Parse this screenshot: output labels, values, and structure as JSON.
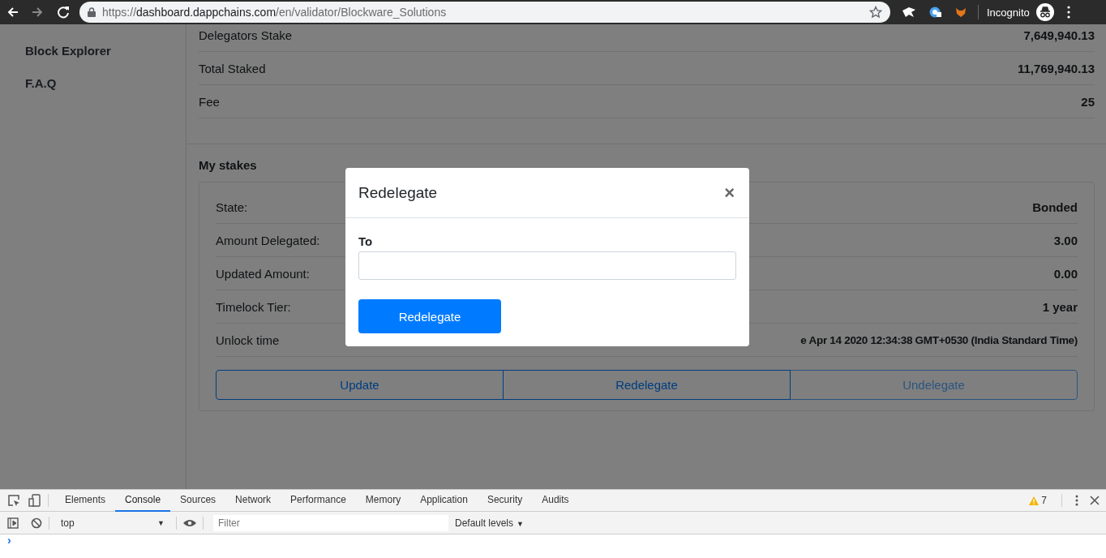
{
  "browser": {
    "url_scheme": "https://",
    "url_host": "dashboard.dappchains.com",
    "url_path": "/en/validator/Blockware_Solutions",
    "profile_label": "Incognito",
    "forward_disabled": true
  },
  "sidebar": {
    "items": [
      {
        "label": "Block Explorer"
      },
      {
        "label": "F.A.Q"
      }
    ]
  },
  "validator_details": [
    {
      "label": "Delegators Stake",
      "value": "7,649,940.13"
    },
    {
      "label": "Total Staked",
      "value": "11,769,940.13"
    },
    {
      "label": "Fee",
      "value": "25"
    }
  ],
  "my_stakes": {
    "title": "My stakes",
    "rows": [
      {
        "label": "State:",
        "value": "Bonded"
      },
      {
        "label": "Amount Delegated:",
        "value": "3.00"
      },
      {
        "label": "Updated Amount:",
        "value": "0.00"
      },
      {
        "label": "Timelock Tier:",
        "value": "1 year"
      },
      {
        "label": "Unlock time",
        "value": "e Apr 14 2020 12:34:38 GMT+0530 (India Standard Time)"
      }
    ],
    "actions": [
      {
        "label": "Update",
        "disabled": false
      },
      {
        "label": "Redelegate",
        "disabled": false
      },
      {
        "label": "Undelegate",
        "disabled": true
      }
    ]
  },
  "modal": {
    "title": "Redelegate",
    "close": "×",
    "field_label": "To",
    "button": "Redelegate"
  },
  "devtools": {
    "tabs": [
      {
        "label": "Elements",
        "selected": false
      },
      {
        "label": "Console",
        "selected": true
      },
      {
        "label": "Sources",
        "selected": false
      },
      {
        "label": "Network",
        "selected": false
      },
      {
        "label": "Performance",
        "selected": false
      },
      {
        "label": "Memory",
        "selected": false
      },
      {
        "label": "Application",
        "selected": false
      },
      {
        "label": "Security",
        "selected": false
      },
      {
        "label": "Audits",
        "selected": false
      }
    ],
    "warning_count": "7",
    "context": "top",
    "filter_placeholder": "Filter",
    "levels": "Default levels",
    "levels_caret": "▼",
    "context_caret": "▼",
    "prompt": "›"
  }
}
